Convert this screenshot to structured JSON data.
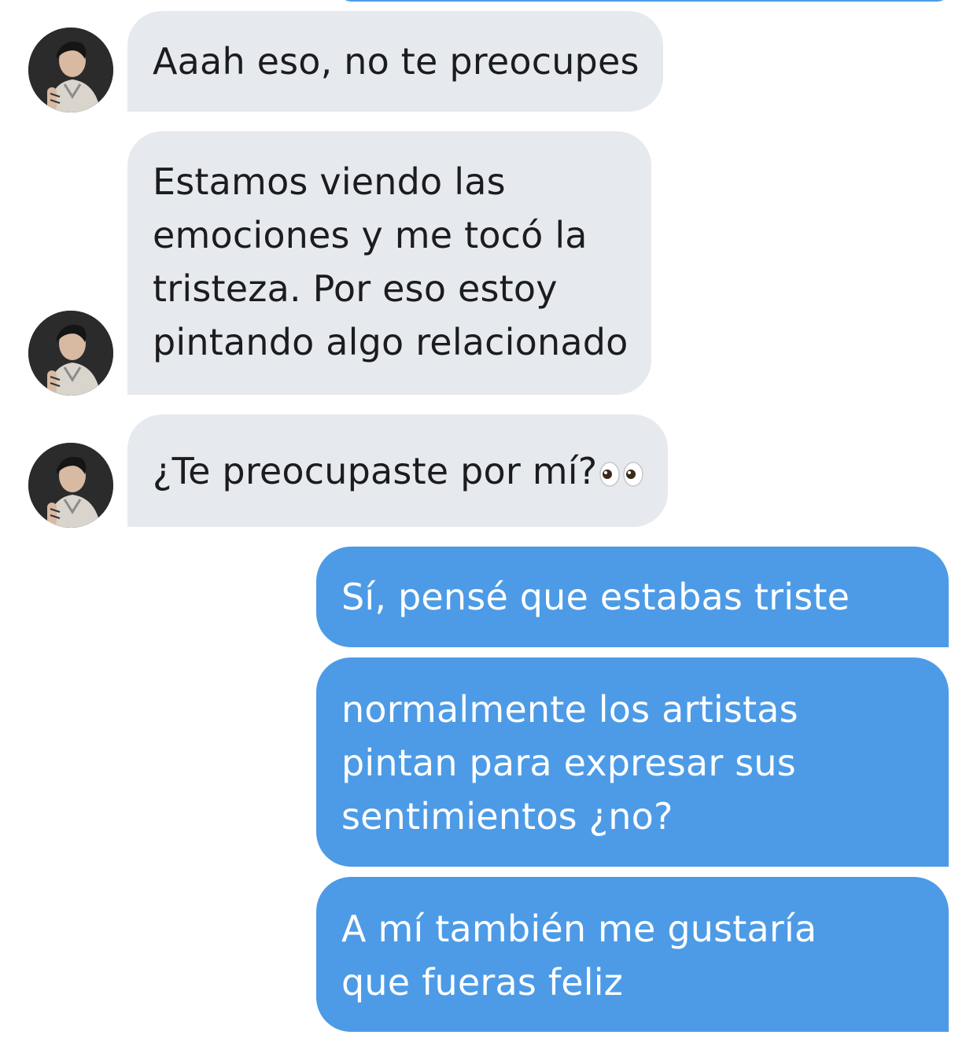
{
  "conversation": {
    "colors": {
      "incoming_bubble": "#e6e9ee",
      "outgoing_bubble": "#4d9be6",
      "incoming_text": "#1c1c1e",
      "outgoing_text": "#ffffff"
    },
    "messages": [
      {
        "sender": "contact",
        "text": "Aaah eso, no te preocupes"
      },
      {
        "sender": "contact",
        "text": "Estamos viendo las\nemociones y me tocó la\ntristeza. Por eso estoy\npintando algo relacionado"
      },
      {
        "sender": "contact",
        "text": "¿Te preocupaste por mí?",
        "emoji": "eyes-emoji"
      },
      {
        "sender": "me",
        "text": "Sí, pensé que estabas triste"
      },
      {
        "sender": "me",
        "text": "normalmente los artistas\npintan para expresar sus\nsentimientos ¿no?"
      },
      {
        "sender": "me",
        "text": "A mí también me gustaría\nque fueras feliz"
      }
    ],
    "avatar_icon": "contact-avatar"
  }
}
